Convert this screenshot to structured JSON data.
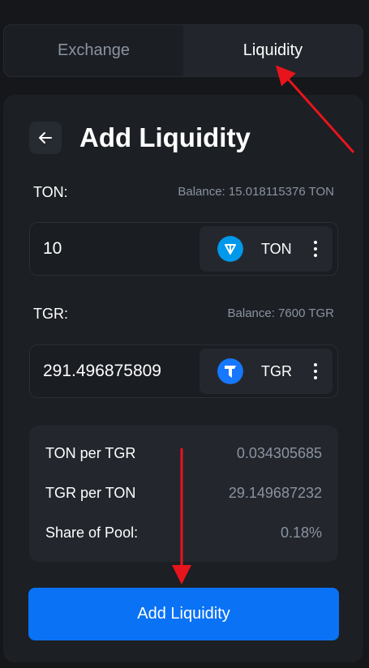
{
  "tabs": [
    {
      "label": "Exchange",
      "active": false
    },
    {
      "label": "Liquidity",
      "active": true
    }
  ],
  "panel": {
    "title": "Add Liquidity",
    "back_icon": "arrow-left-icon"
  },
  "token_a": {
    "label": "TON:",
    "balance": "Balance: 15.018115376 TON",
    "amount": "10",
    "symbol": "TON",
    "icon": "ton-icon",
    "icon_color": "#0098ea"
  },
  "token_b": {
    "label": "TGR:",
    "balance": "Balance: 7600 TGR",
    "amount": "291.496875809",
    "symbol": "TGR",
    "icon": "tgr-icon",
    "icon_color": "#1677ff"
  },
  "info": {
    "rows": [
      {
        "label": "TON per TGR",
        "value": "0.034305685"
      },
      {
        "label": "TGR per TON",
        "value": "29.149687232"
      },
      {
        "label": "Share of Pool:",
        "value": "0.18%"
      }
    ]
  },
  "submit_label": "Add Liquidity",
  "colors": {
    "accent": "#0a72f5",
    "annotation_arrow": "#e8141c",
    "background": "#15171b",
    "card": "#1c1f24"
  }
}
